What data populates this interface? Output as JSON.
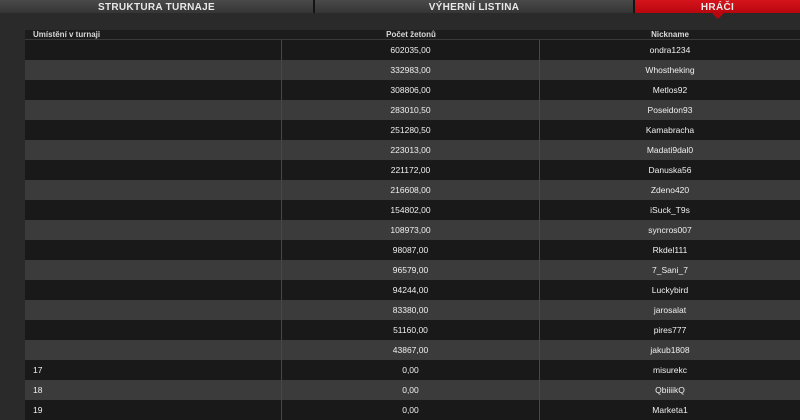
{
  "tabs": [
    {
      "label": "STRUKTURA TURNAJE",
      "active": false
    },
    {
      "label": "VÝHERNÍ LISTINA",
      "active": false
    },
    {
      "label": "HRÁČI",
      "active": true
    }
  ],
  "table": {
    "headers": [
      "Umístění v turnaji",
      "Počet žetonů",
      "Nickname"
    ],
    "rows": [
      {
        "place": "",
        "chips": "602035,00",
        "nick": "ondra1234"
      },
      {
        "place": "",
        "chips": "332983,00",
        "nick": "Whostheking"
      },
      {
        "place": "",
        "chips": "308806,00",
        "nick": "Metlos92"
      },
      {
        "place": "",
        "chips": "283010,50",
        "nick": "Poseidon93"
      },
      {
        "place": "",
        "chips": "251280,50",
        "nick": "Kamabracha"
      },
      {
        "place": "",
        "chips": "223013,00",
        "nick": "Madati9dal0"
      },
      {
        "place": "",
        "chips": "221172,00",
        "nick": "Danuska56"
      },
      {
        "place": "",
        "chips": "216608,00",
        "nick": "Zdeno420"
      },
      {
        "place": "",
        "chips": "154802,00",
        "nick": "iSuck_T9s"
      },
      {
        "place": "",
        "chips": "108973,00",
        "nick": "syncros007"
      },
      {
        "place": "",
        "chips": "98087,00",
        "nick": "Rkdel111"
      },
      {
        "place": "",
        "chips": "96579,00",
        "nick": "7_Sani_7"
      },
      {
        "place": "",
        "chips": "94244,00",
        "nick": "Luckybird"
      },
      {
        "place": "",
        "chips": "83380,00",
        "nick": "jarosalat"
      },
      {
        "place": "",
        "chips": "51160,00",
        "nick": "pires777"
      },
      {
        "place": "",
        "chips": "43867,00",
        "nick": "jakub1808"
      },
      {
        "place": "17",
        "chips": "0,00",
        "nick": "misurekc"
      },
      {
        "place": "18",
        "chips": "0,00",
        "nick": "QbiiiikQ"
      },
      {
        "place": "19",
        "chips": "0,00",
        "nick": "Marketa1"
      }
    ]
  }
}
